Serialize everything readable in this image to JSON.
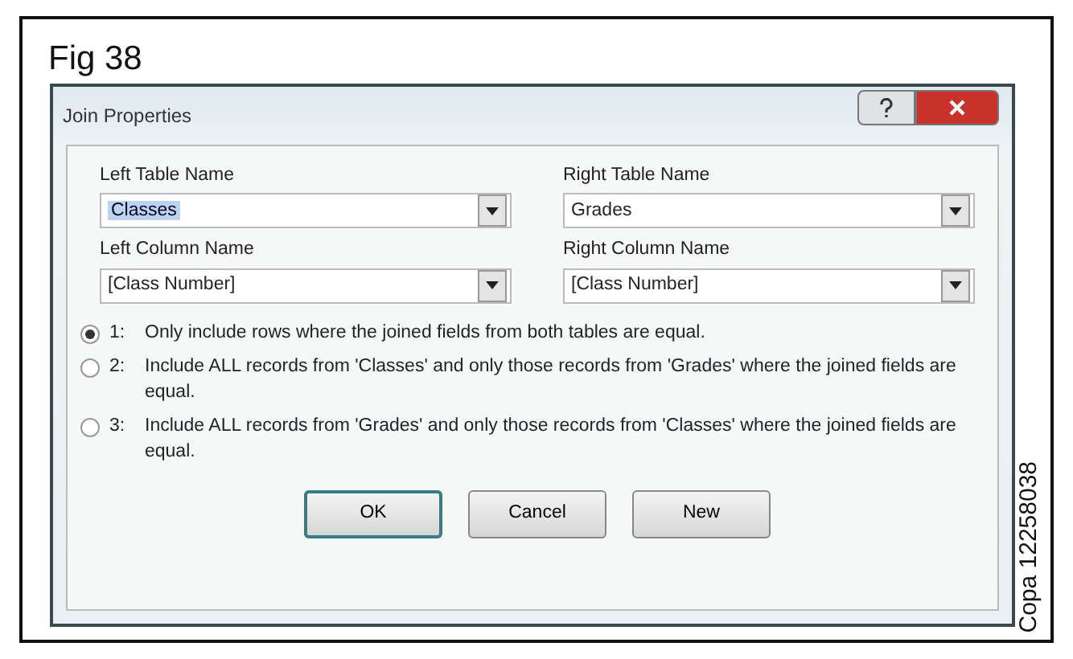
{
  "figure": {
    "caption": "Fig 38",
    "code": "Copa 12258038"
  },
  "window": {
    "title": "Join Properties"
  },
  "fields": [
    {
      "label": "Left Table Name",
      "value": "Classes",
      "selected": true
    },
    {
      "label": "Right Table Name",
      "value": "Grades",
      "selected": false
    },
    {
      "label": "Left Column Name",
      "value": "[Class Number]",
      "selected": false
    },
    {
      "label": "Right Column Name",
      "value": "[Class Number]",
      "selected": false
    }
  ],
  "options": [
    {
      "number": "1:",
      "text": "Only include rows where the joined fields from both tables are equal.",
      "selected": true
    },
    {
      "number": "2:",
      "text": "Include ALL records from 'Classes' and only those records from 'Grades' where the joined fields are equal.",
      "selected": false
    },
    {
      "number": "3:",
      "text": "Include ALL records from 'Grades' and only those records from 'Classes' where the joined fields are equal.",
      "selected": false
    }
  ],
  "buttons": [
    {
      "label": "OK",
      "default": true
    },
    {
      "label": "Cancel",
      "default": false
    },
    {
      "label": "New",
      "default": false
    }
  ]
}
